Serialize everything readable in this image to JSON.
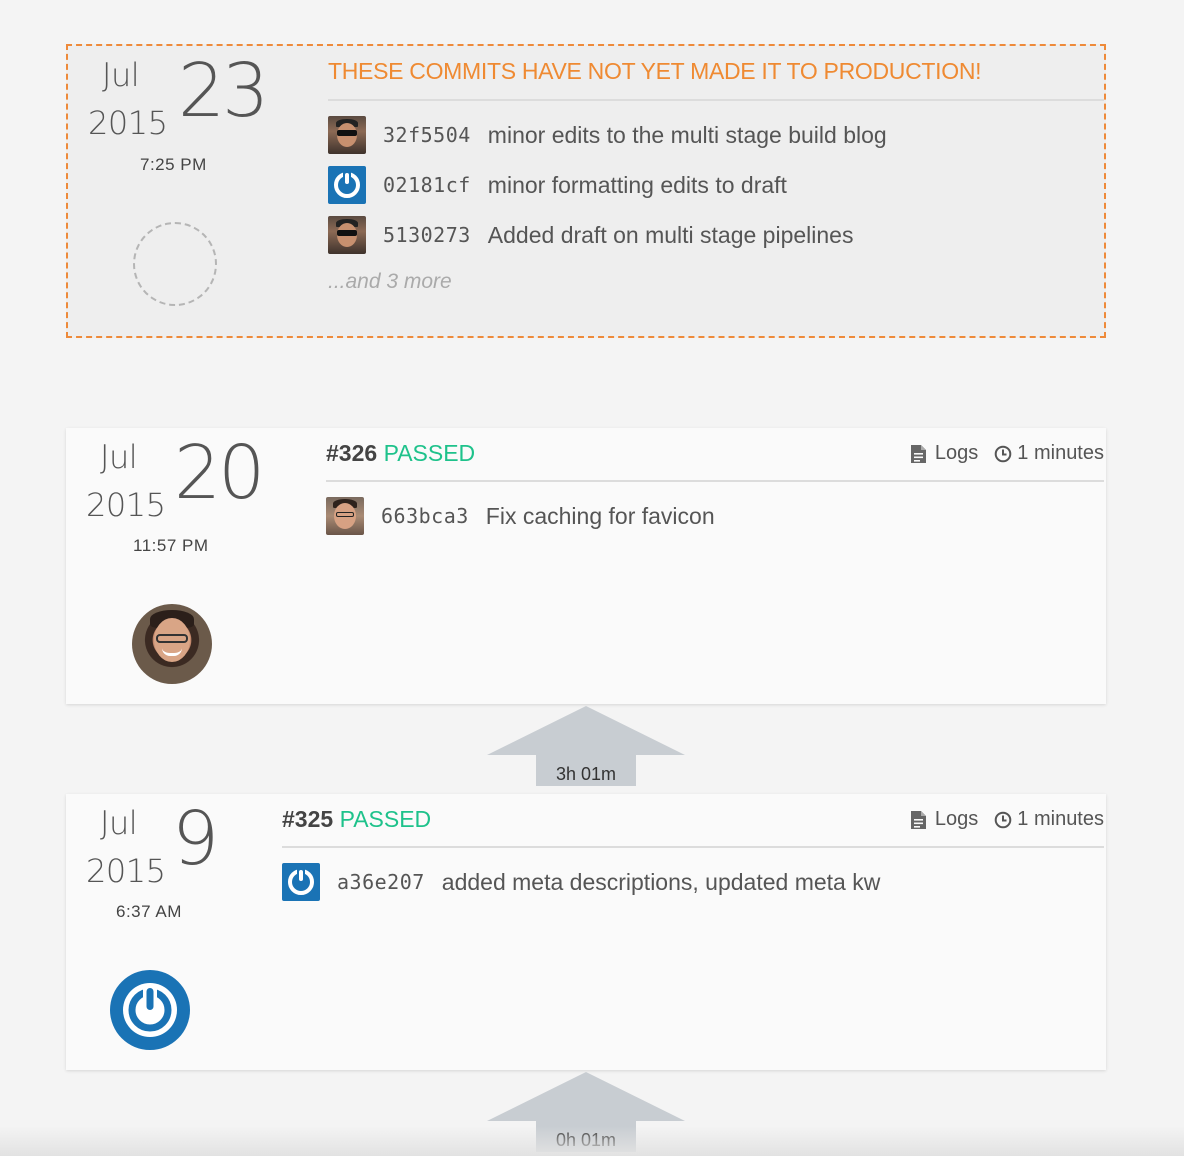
{
  "pending": {
    "month": "Jul",
    "year": "2015",
    "day": "23",
    "time": "7:25 PM",
    "title": "THESE COMMITS HAVE NOT YET MADE IT TO PRODUCTION!",
    "commits": [
      {
        "sha": "32f5504",
        "message": "minor edits to the multi stage build blog",
        "avatar": "user-photo"
      },
      {
        "sha": "02181cf",
        "message": "minor formatting edits to draft",
        "avatar": "power-icon"
      },
      {
        "sha": "5130273",
        "message": "Added draft on multi stage pipelines",
        "avatar": "user-photo"
      }
    ],
    "more": "...and 3 more"
  },
  "builds": [
    {
      "month": "Jul",
      "year": "2015",
      "day": "20",
      "time": "11:57 PM",
      "number": "#326",
      "status": "PASSED",
      "logs_label": "Logs",
      "duration": "1 minutes",
      "commits": [
        {
          "sha": "663bca3",
          "message": "Fix caching for favicon",
          "avatar": "user-photo"
        }
      ],
      "author_avatar": "user-photo"
    },
    {
      "month": "Jul",
      "year": "2015",
      "day": "9",
      "time": "6:37 AM",
      "number": "#325",
      "status": "PASSED",
      "logs_label": "Logs",
      "duration": "1 minutes",
      "commits": [
        {
          "sha": "a36e207",
          "message": "added meta descriptions, updated meta kw",
          "avatar": "power-icon"
        }
      ],
      "author_avatar": "power-icon"
    }
  ],
  "gaps": [
    "3h 01m",
    "0h 01m"
  ],
  "colors": {
    "pending_accent": "#ef8a32",
    "passed": "#1ec28b",
    "power_blue": "#1a73b5",
    "arrow_gray": "#c8cdd2"
  }
}
